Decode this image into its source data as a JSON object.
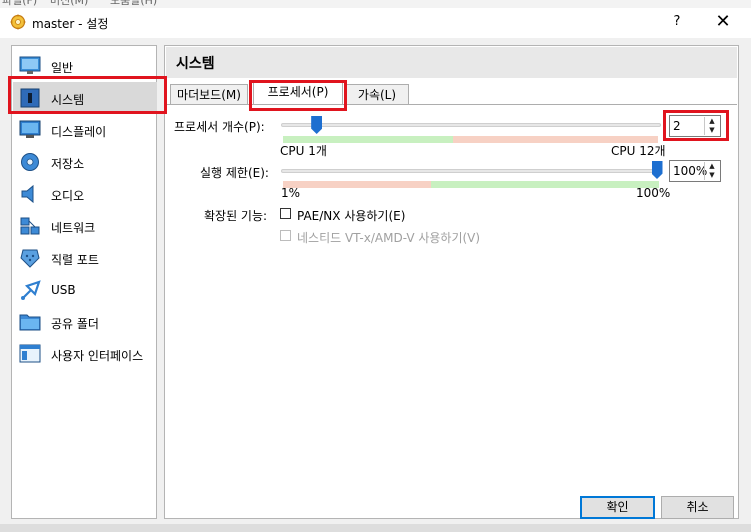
{
  "menubar": {
    "items": [
      "파일(F)",
      "머신(M)",
      "도움말(H)"
    ]
  },
  "window": {
    "title": "master - 설정",
    "help": "?",
    "close": "✕"
  },
  "sidebar": {
    "items": [
      {
        "label": "일반",
        "icon": "monitor-icon"
      },
      {
        "label": "시스템",
        "icon": "chip-icon"
      },
      {
        "label": "디스플레이",
        "icon": "display-icon"
      },
      {
        "label": "저장소",
        "icon": "disk-icon"
      },
      {
        "label": "오디오",
        "icon": "speaker-icon"
      },
      {
        "label": "네트워크",
        "icon": "network-icon"
      },
      {
        "label": "직렬 포트",
        "icon": "serial-port-icon"
      },
      {
        "label": "USB",
        "icon": "usb-icon"
      },
      {
        "label": "공유 폴더",
        "icon": "folder-icon"
      },
      {
        "label": "사용자 인터페이스",
        "icon": "ui-icon"
      }
    ],
    "selected": "시스템"
  },
  "section": {
    "title": "시스템"
  },
  "tabs": [
    {
      "label": "마더보드(M)",
      "active": false
    },
    {
      "label": "프로세서(P)",
      "active": true
    },
    {
      "label": "가속(L)",
      "active": false
    }
  ],
  "processor": {
    "count_label": "프로세서 개수(P):",
    "count_value": "2",
    "count_fraction": 0.09,
    "min_label": "CPU 1개",
    "max_label": "CPU 12개",
    "exec_label": "실행 제한(E):",
    "exec_value": "100%",
    "exec_fraction": 1.0,
    "exec_min_label": "1%",
    "exec_max_label": "100%",
    "ext_label": "확장된 기능:",
    "pae_label": "PAE/NX 사용하기(E)",
    "vtx_label": "네스티드 VT-x/AMD-V 사용하기(V)"
  },
  "buttons": {
    "ok": "확인",
    "cancel": "취소"
  },
  "colors": {
    "highlight": "#e0141e",
    "slider_handle": "#1e6fd0",
    "safe_zone": "#c8f0c0",
    "warn_zone": "#f7d1c4"
  }
}
